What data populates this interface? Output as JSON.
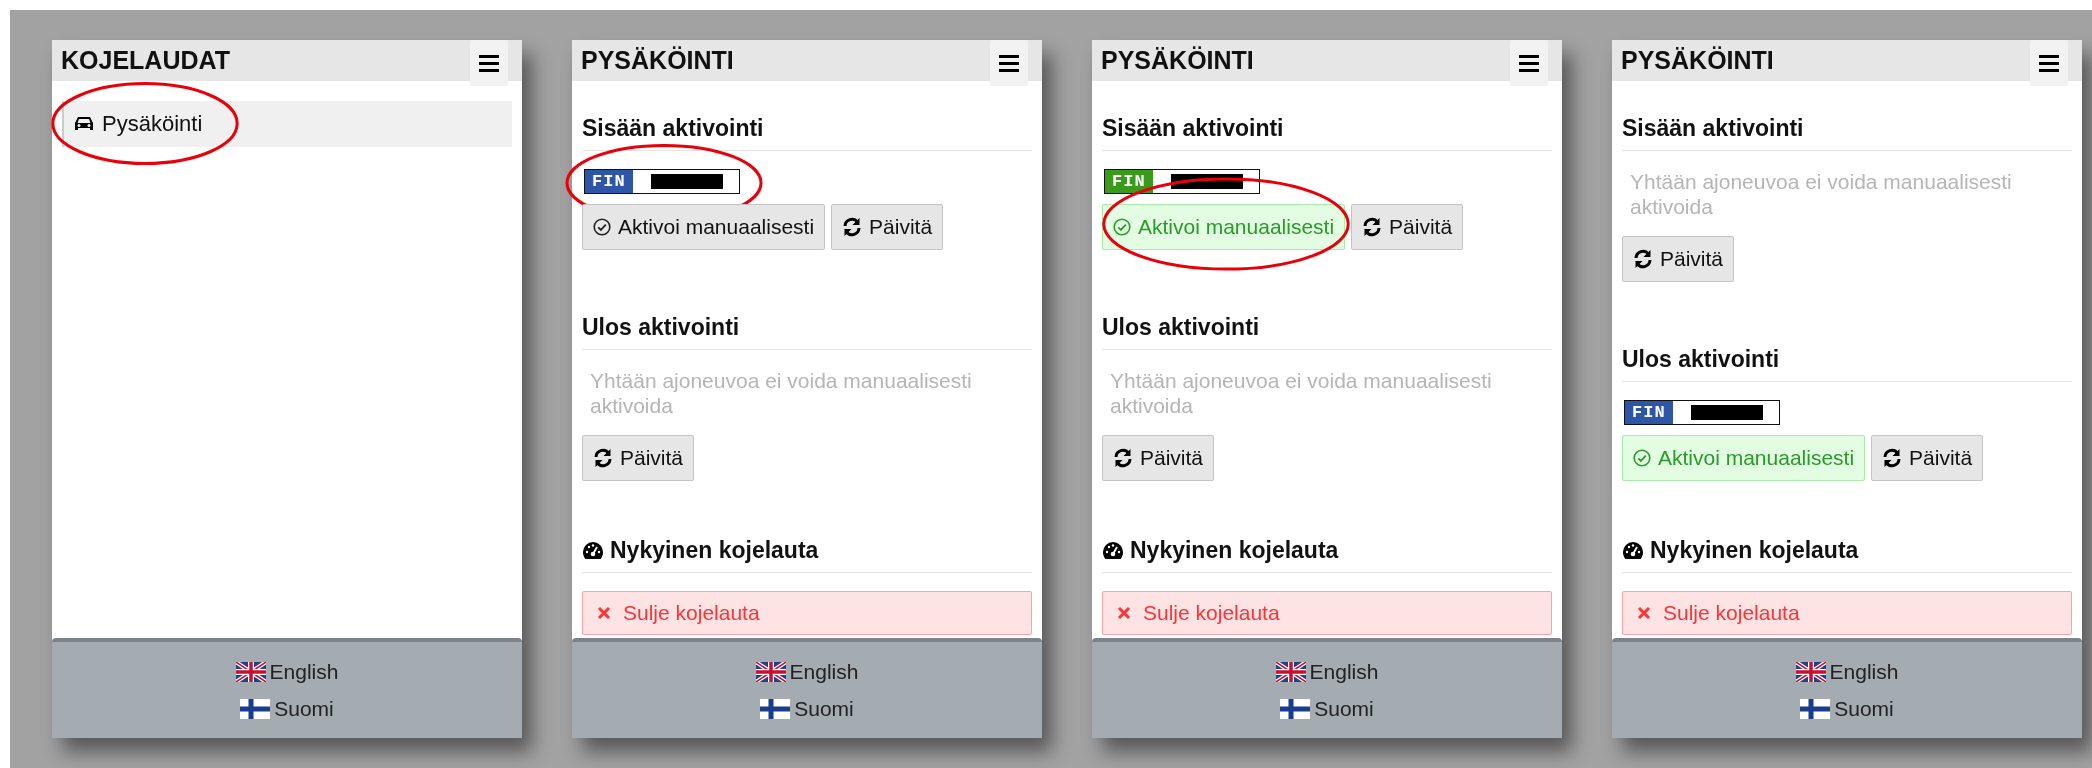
{
  "panels": [
    {
      "title": "KOJELAUDAT",
      "kind": "menu",
      "items": [
        {
          "label": "Pysäköinti",
          "circled": true
        }
      ],
      "languages": [
        {
          "label": "English",
          "kind": "uk"
        },
        {
          "label": "Suomi",
          "kind": "fi"
        }
      ]
    },
    {
      "title": "PYSÄKÖINTI",
      "kind": "parking",
      "sections": [
        {
          "kind": "vehicle",
          "heading": "Sisään aktivointi",
          "plate": {
            "country": "FIN",
            "color": "#2f56a6",
            "circled": true
          },
          "activate": {
            "label": "Aktivoi manuaalisesti",
            "activated": false
          },
          "refresh": "Päivitä"
        },
        {
          "kind": "empty",
          "heading": "Ulos aktivointi",
          "message": "Yhtään ajoneuvoa ei voida manuaalisesti aktivoida",
          "refresh": "Päivitä"
        },
        {
          "kind": "dashboard",
          "heading": "Nykyinen kojelauta",
          "close": "Sulje kojelauta"
        }
      ],
      "languages": [
        {
          "label": "English",
          "kind": "uk"
        },
        {
          "label": "Suomi",
          "kind": "fi"
        }
      ]
    },
    {
      "title": "PYSÄKÖINTI",
      "kind": "parking",
      "sections": [
        {
          "kind": "vehicle",
          "heading": "Sisään aktivointi",
          "plate": {
            "country": "FIN",
            "color": "#3a9a1a"
          },
          "activate": {
            "label": "Aktivoi manuaalisesti",
            "activated": true,
            "circled": true
          },
          "refresh": "Päivitä"
        },
        {
          "kind": "empty",
          "heading": "Ulos aktivointi",
          "message": "Yhtään ajoneuvoa ei voida manuaalisesti aktivoida",
          "refresh": "Päivitä"
        },
        {
          "kind": "dashboard",
          "heading": "Nykyinen kojelauta",
          "close": "Sulje kojelauta"
        }
      ],
      "languages": [
        {
          "label": "English",
          "kind": "uk"
        },
        {
          "label": "Suomi",
          "kind": "fi"
        }
      ]
    },
    {
      "title": "PYSÄKÖINTI",
      "kind": "parking",
      "sections": [
        {
          "kind": "empty",
          "heading": "Sisään aktivointi",
          "message": "Yhtään ajoneuvoa ei voida manuaalisesti aktivoida",
          "refresh": "Päivitä"
        },
        {
          "kind": "vehicle",
          "heading": "Ulos aktivointi",
          "plate": {
            "country": "FIN",
            "color": "#2f56a6"
          },
          "activate": {
            "label": "Aktivoi manuaalisesti",
            "activated": true
          },
          "refresh": "Päivitä"
        },
        {
          "kind": "dashboard",
          "heading": "Nykyinen kojelauta",
          "close": "Sulje kojelauta"
        }
      ],
      "languages": [
        {
          "label": "English",
          "kind": "uk"
        },
        {
          "label": "Suomi",
          "kind": "fi"
        }
      ]
    }
  ]
}
